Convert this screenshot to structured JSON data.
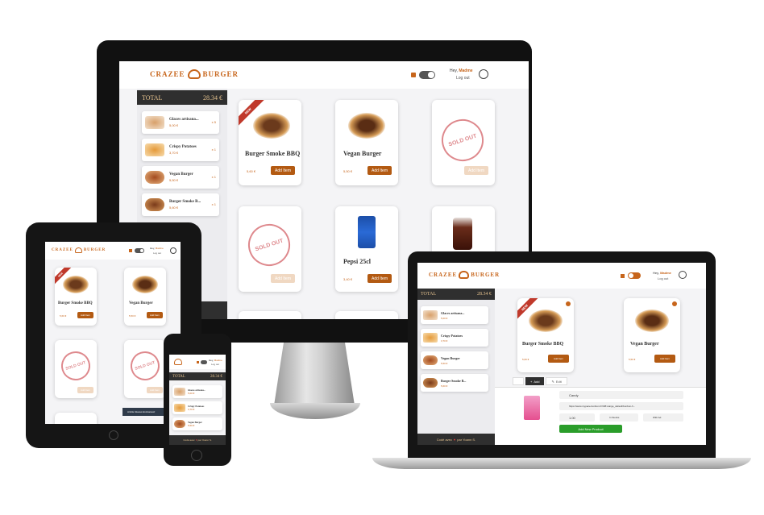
{
  "brand": {
    "left": "CRAZEE",
    "right": "BURGER"
  },
  "header": {
    "greeting": "Hey,",
    "user": "Madme",
    "logout": "Log out"
  },
  "total": {
    "label": "TOTAL",
    "amount": "28.34 €"
  },
  "basket": [
    {
      "name": "Glaces artisana...",
      "price": "5,00 €",
      "qty": "x 5"
    },
    {
      "name": "Crispy Potatoes",
      "price": "3,70 €",
      "qty": "x 1"
    },
    {
      "name": "Vegan Burger",
      "price": "5,50 €",
      "qty": "x 1"
    },
    {
      "name": "Burger Smoke B...",
      "price": "5,60 €",
      "qty": "x 1"
    }
  ],
  "products": [
    {
      "name": "Burger Smoke BBQ",
      "price": "5,60 €",
      "badge": "NEW",
      "status": "available"
    },
    {
      "name": "Vegan Burger",
      "price": "5,50 €",
      "status": "available"
    },
    {
      "name": "",
      "price": "",
      "status": "sold_out"
    },
    {
      "name": "",
      "price": "",
      "status": "sold_out"
    },
    {
      "name": "Pepsi 25cl",
      "price": "3,40 €",
      "status": "available"
    },
    {
      "name": "",
      "price": "",
      "status": "available"
    }
  ],
  "add_button": "Add Item",
  "sold_out": "SOLD OUT",
  "footer": {
    "text_before": "Codé avec",
    "text_after": "par Yoann S."
  },
  "admin": {
    "tab_add": "Add",
    "tab_edit": "Edit",
    "name_value": "Candy",
    "image_url": "https://www.mypace-bonbon.fr/3381-large_default/bonbon-h...",
    "price_value": "1.00",
    "stock_value": "In Stocks",
    "ad_value": "With Ad",
    "submit": "Add New Product"
  },
  "toast": "Article Glaces Exclusives!",
  "colors": {
    "brand": "#c7651b",
    "button": "#b35a12",
    "dark": "#2f2f2f",
    "ribbon": "#c0392b",
    "sold_out": "#d9757a",
    "submit": "#2a9d2a"
  },
  "icons": [
    "burger-logo-icon",
    "lock-icon",
    "toggle-switch",
    "avatar-icon",
    "heart-icon",
    "close-icon",
    "plus-icon",
    "pencil-icon"
  ]
}
